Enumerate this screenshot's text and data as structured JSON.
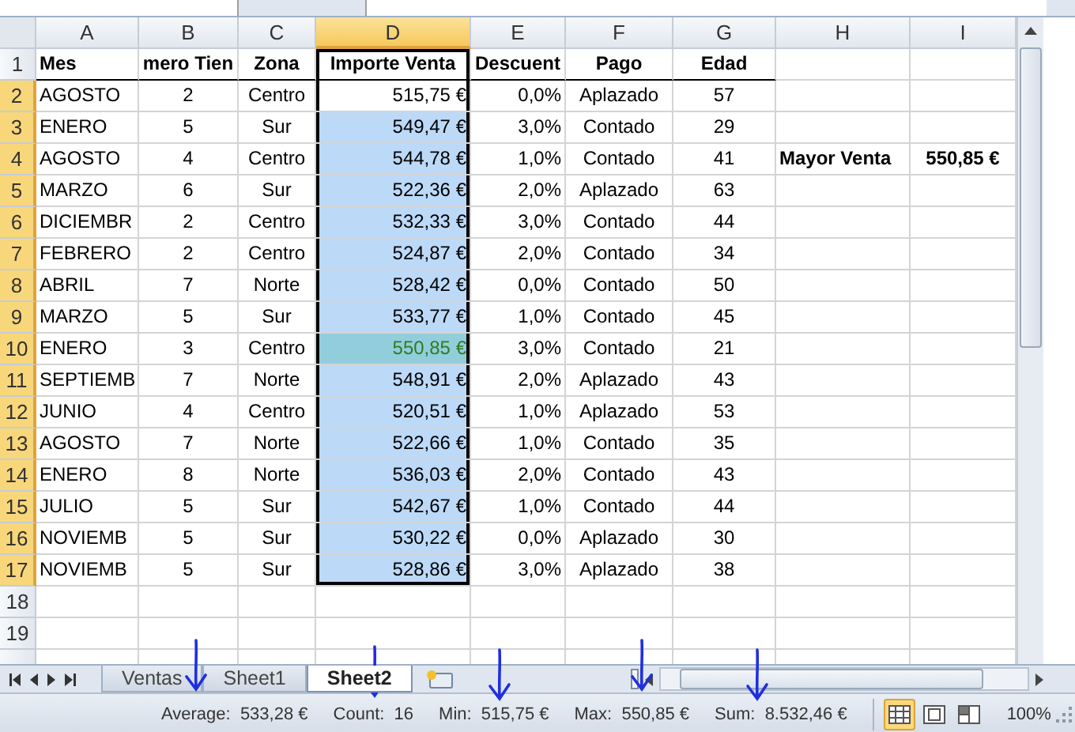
{
  "columns": [
    {
      "label": "A",
      "selected": false
    },
    {
      "label": "B",
      "selected": false
    },
    {
      "label": "C",
      "selected": false
    },
    {
      "label": "D",
      "selected": true
    },
    {
      "label": "E",
      "selected": false
    },
    {
      "label": "F",
      "selected": false
    },
    {
      "label": "G",
      "selected": false
    },
    {
      "label": "H",
      "selected": false
    },
    {
      "label": "I",
      "selected": false
    }
  ],
  "header_row": {
    "number": "1",
    "cells": [
      "Mes",
      "mero Tien",
      "Zona",
      "Importe Venta",
      "Descuent",
      "Pago",
      "Edad"
    ]
  },
  "rows": [
    {
      "number": "2",
      "selected": true,
      "active": true,
      "highlighted": false,
      "cells": [
        "AGOSTO",
        "2",
        "Centro",
        "515,75 €",
        "0,0%",
        "Aplazado",
        "57"
      ]
    },
    {
      "number": "3",
      "selected": true,
      "active": false,
      "highlighted": false,
      "cells": [
        "ENERO",
        "5",
        "Sur",
        "549,47 €",
        "3,0%",
        "Contado",
        "29"
      ]
    },
    {
      "number": "4",
      "selected": true,
      "active": false,
      "highlighted": false,
      "cells": [
        "AGOSTO",
        "4",
        "Centro",
        "544,78 €",
        "1,0%",
        "Contado",
        "41"
      ],
      "note": {
        "label": "Mayor Venta",
        "value": "550,85 €"
      }
    },
    {
      "number": "5",
      "selected": true,
      "active": false,
      "highlighted": false,
      "cells": [
        "MARZO",
        "6",
        "Sur",
        "522,36 €",
        "2,0%",
        "Aplazado",
        "63"
      ]
    },
    {
      "number": "6",
      "selected": true,
      "active": false,
      "highlighted": false,
      "cells": [
        "DICIEMBR",
        "2",
        "Centro",
        "532,33 €",
        "3,0%",
        "Contado",
        "44"
      ]
    },
    {
      "number": "7",
      "selected": true,
      "active": false,
      "highlighted": false,
      "cells": [
        "FEBRERO",
        "2",
        "Centro",
        "524,87 €",
        "2,0%",
        "Contado",
        "34"
      ]
    },
    {
      "number": "8",
      "selected": true,
      "active": false,
      "highlighted": false,
      "cells": [
        "ABRIL",
        "7",
        "Norte",
        "528,42 €",
        "0,0%",
        "Contado",
        "50"
      ]
    },
    {
      "number": "9",
      "selected": true,
      "active": false,
      "highlighted": false,
      "cells": [
        "MARZO",
        "5",
        "Sur",
        "533,77 €",
        "1,0%",
        "Contado",
        "45"
      ]
    },
    {
      "number": "10",
      "selected": true,
      "active": false,
      "highlighted": true,
      "cells": [
        "ENERO",
        "3",
        "Centro",
        "550,85 €",
        "3,0%",
        "Contado",
        "21"
      ]
    },
    {
      "number": "11",
      "selected": true,
      "active": false,
      "highlighted": false,
      "cells": [
        "SEPTIEMB",
        "7",
        "Norte",
        "548,91 €",
        "2,0%",
        "Aplazado",
        "43"
      ]
    },
    {
      "number": "12",
      "selected": true,
      "active": false,
      "highlighted": false,
      "cells": [
        "JUNIO",
        "4",
        "Centro",
        "520,51 €",
        "1,0%",
        "Aplazado",
        "53"
      ]
    },
    {
      "number": "13",
      "selected": true,
      "active": false,
      "highlighted": false,
      "cells": [
        "AGOSTO",
        "7",
        "Norte",
        "522,66 €",
        "1,0%",
        "Contado",
        "35"
      ]
    },
    {
      "number": "14",
      "selected": true,
      "active": false,
      "highlighted": false,
      "cells": [
        "ENERO",
        "8",
        "Norte",
        "536,03 €",
        "2,0%",
        "Contado",
        "43"
      ]
    },
    {
      "number": "15",
      "selected": true,
      "active": false,
      "highlighted": false,
      "cells": [
        "JULIO",
        "5",
        "Sur",
        "542,67 €",
        "1,0%",
        "Contado",
        "44"
      ]
    },
    {
      "number": "16",
      "selected": true,
      "active": false,
      "highlighted": false,
      "cells": [
        "NOVIEMB",
        "5",
        "Sur",
        "530,22 €",
        "0,0%",
        "Aplazado",
        "30"
      ]
    },
    {
      "number": "17",
      "selected": true,
      "active": false,
      "highlighted": false,
      "cells": [
        "NOVIEMB",
        "5",
        "Sur",
        "528,86 €",
        "3,0%",
        "Aplazado",
        "38"
      ]
    }
  ],
  "empty_rows": [
    "18",
    "19"
  ],
  "sheet_tabs": [
    {
      "label": "Ventas",
      "selected": false
    },
    {
      "label": "Sheet1",
      "selected": false
    },
    {
      "label": "Sheet2",
      "selected": true
    }
  ],
  "status_bar": {
    "stats": [
      {
        "label": "Average:",
        "value": "533,28 €"
      },
      {
        "label": "Count:",
        "value": "16"
      },
      {
        "label": "Min:",
        "value": "515,75 €"
      },
      {
        "label": "Max:",
        "value": "550,85 €"
      },
      {
        "label": "Sum:",
        "value": "8.532,46 €"
      }
    ],
    "views": [
      {
        "kind": "normal",
        "selected": true
      },
      {
        "kind": "layout",
        "selected": false
      },
      {
        "kind": "pagebreak",
        "selected": false
      }
    ],
    "zoom": "100%"
  }
}
